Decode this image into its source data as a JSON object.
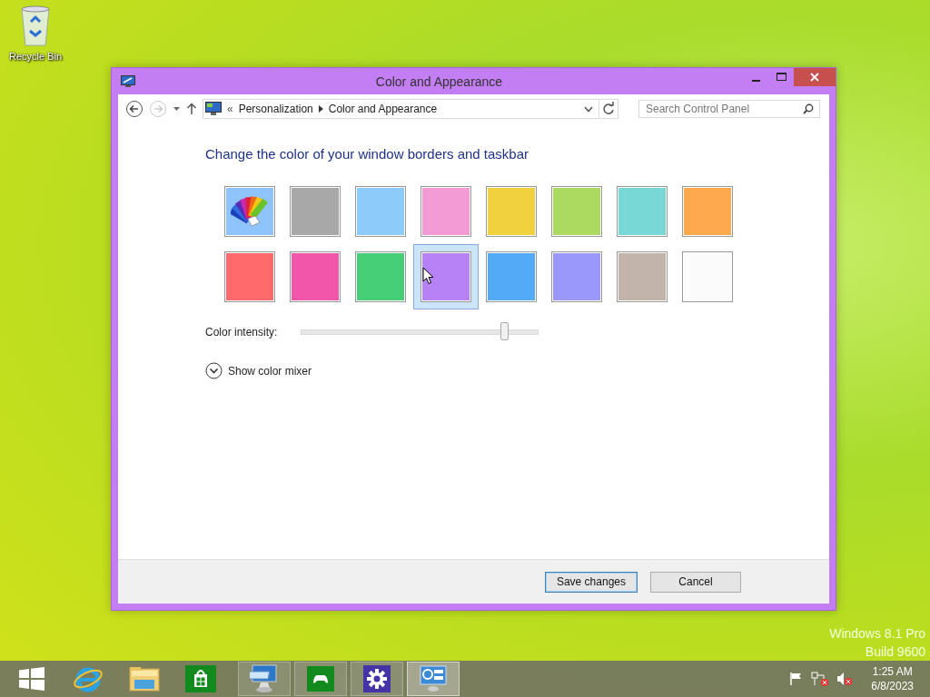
{
  "desktop": {
    "icons": [
      {
        "label": "Recycle Bin"
      }
    ],
    "edition": {
      "name": "Windows 8.1 Pro",
      "build": "Build 9600"
    }
  },
  "window": {
    "title": "Color and Appearance",
    "address": {
      "prefix": "«",
      "crumbs": [
        "Personalization",
        "Color and Appearance"
      ]
    },
    "search": {
      "placeholder": "Search Control Panel"
    },
    "heading": "Change the color of your window borders and taskbar",
    "swatches": [
      {
        "kind": "auto",
        "color": "#8ec3fb",
        "selected": false
      },
      {
        "kind": "color",
        "color": "#a8a8a8",
        "selected": false
      },
      {
        "kind": "color",
        "color": "#8dcbfa",
        "selected": false
      },
      {
        "kind": "color",
        "color": "#f29bd4",
        "selected": false
      },
      {
        "kind": "color",
        "color": "#f2d13f",
        "selected": false
      },
      {
        "kind": "color",
        "color": "#acd95f",
        "selected": false
      },
      {
        "kind": "color",
        "color": "#78d8d6",
        "selected": false
      },
      {
        "kind": "color",
        "color": "#ffa94f",
        "selected": false
      },
      {
        "kind": "color",
        "color": "#ff6b6d",
        "selected": false
      },
      {
        "kind": "color",
        "color": "#f256aa",
        "selected": false
      },
      {
        "kind": "color",
        "color": "#47cf78",
        "selected": false
      },
      {
        "kind": "color",
        "color": "#b682f6",
        "selected": true
      },
      {
        "kind": "color",
        "color": "#53abf7",
        "selected": false
      },
      {
        "kind": "color",
        "color": "#9a98fa",
        "selected": false
      },
      {
        "kind": "color",
        "color": "#c2b4aa",
        "selected": false
      },
      {
        "kind": "color",
        "color": "#fbfbfb",
        "selected": false
      }
    ],
    "intensity": {
      "label": "Color intensity:",
      "level": 0.86
    },
    "mixer": {
      "label": "Show color mixer",
      "expanded": false
    },
    "buttons": [
      {
        "label": "Save changes",
        "default": true
      },
      {
        "label": "Cancel",
        "default": false
      }
    ]
  },
  "taskbar": {
    "items": [
      {
        "kind": "start",
        "running": false,
        "selected": false
      },
      {
        "kind": "browser",
        "running": false,
        "selected": false
      },
      {
        "kind": "folder",
        "running": false,
        "selected": false
      },
      {
        "kind": "store",
        "running": false,
        "selected": false
      },
      {
        "kind": "keyboard",
        "running": true,
        "selected": false
      },
      {
        "kind": "gamepad",
        "running": true,
        "selected": false
      },
      {
        "kind": "gear",
        "running": true,
        "selected": false
      },
      {
        "kind": "panel",
        "running": true,
        "selected": true
      }
    ],
    "clock": {
      "time": "1:25 AM",
      "date": "6/8/2023"
    }
  }
}
